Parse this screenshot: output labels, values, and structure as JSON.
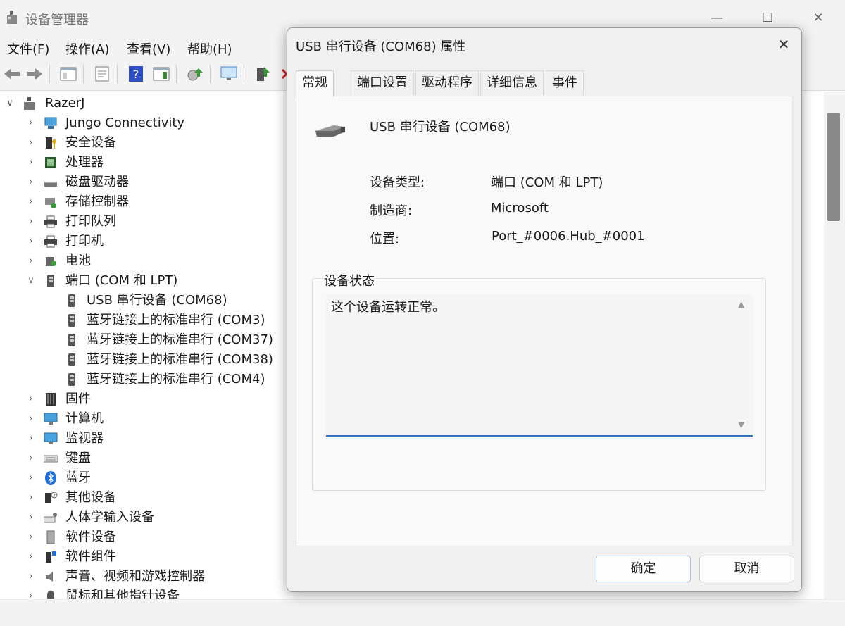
{
  "window": {
    "title": "设备管理器",
    "controls": {
      "minimize": "—",
      "maximize": "☐",
      "close": "✕"
    }
  },
  "menu": [
    "文件(F)",
    "操作(A)",
    "查看(V)",
    "帮助(H)"
  ],
  "toolbar": {
    "icons": [
      "back-icon",
      "forward-icon",
      "console-tree-icon",
      "properties-icon",
      "help-icon",
      "action-pane-icon",
      "scan-hardware-icon",
      "monitor-icon",
      "update-driver-icon",
      "uninstall-icon"
    ]
  },
  "tree": {
    "root": {
      "label": "RazerJ",
      "expanded": true
    },
    "nodes": [
      {
        "label": "Jungo Connectivity",
        "icon": "network-icon"
      },
      {
        "label": "安全设备",
        "icon": "security-icon"
      },
      {
        "label": "处理器",
        "icon": "cpu-icon"
      },
      {
        "label": "磁盘驱动器",
        "icon": "disk-icon"
      },
      {
        "label": "存储控制器",
        "icon": "storage-icon"
      },
      {
        "label": "打印队列",
        "icon": "printer-icon"
      },
      {
        "label": "打印机",
        "icon": "printer-icon"
      },
      {
        "label": "电池",
        "icon": "battery-icon"
      },
      {
        "label": "端口 (COM 和 LPT)",
        "icon": "port-icon",
        "expanded": true,
        "children": [
          {
            "label": "USB 串行设备 (COM68)",
            "icon": "port-icon"
          },
          {
            "label": "蓝牙链接上的标准串行 (COM3)",
            "icon": "port-icon"
          },
          {
            "label": "蓝牙链接上的标准串行 (COM37)",
            "icon": "port-icon"
          },
          {
            "label": "蓝牙链接上的标准串行 (COM38)",
            "icon": "port-icon"
          },
          {
            "label": "蓝牙链接上的标准串行 (COM4)",
            "icon": "port-icon"
          }
        ]
      },
      {
        "label": "固件",
        "icon": "firmware-icon"
      },
      {
        "label": "计算机",
        "icon": "computer-icon"
      },
      {
        "label": "监视器",
        "icon": "monitor-icon"
      },
      {
        "label": "键盘",
        "icon": "keyboard-icon"
      },
      {
        "label": "蓝牙",
        "icon": "bluetooth-icon"
      },
      {
        "label": "其他设备",
        "icon": "unknown-device-icon"
      },
      {
        "label": "人体学输入设备",
        "icon": "hid-icon"
      },
      {
        "label": "软件设备",
        "icon": "software-device-icon"
      },
      {
        "label": "软件组件",
        "icon": "software-component-icon"
      },
      {
        "label": "声音、视频和游戏控制器",
        "icon": "speaker-icon"
      },
      {
        "label": "鼠标和其他指针设备",
        "icon": "mouse-icon"
      }
    ]
  },
  "dialog": {
    "title": "USB 串行设备 (COM68) 属性",
    "close": "✕",
    "tabs": [
      "常规",
      "端口设置",
      "驱动程序",
      "详细信息",
      "事件"
    ],
    "active_tab": "常规",
    "device_name": "USB 串行设备 (COM68)",
    "fields": {
      "type_label": "设备类型:",
      "type_value": "端口 (COM 和 LPT)",
      "manufacturer_label": "制造商:",
      "manufacturer_value": "Microsoft",
      "location_label": "位置:",
      "location_value": "Port_#0006.Hub_#0001"
    },
    "status_legend": "设备状态",
    "status_text": "这个设备运转正常。",
    "ok": "确定",
    "cancel": "取消"
  }
}
